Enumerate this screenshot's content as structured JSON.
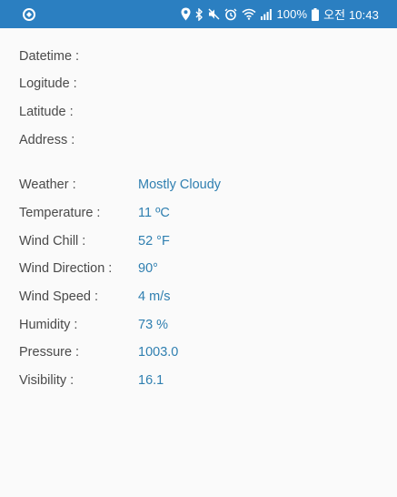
{
  "status_bar": {
    "battery_text": "100%",
    "time_text": "오전 10:43",
    "bg_color": "#2b7fc1",
    "icons": [
      "app-sync-icon",
      "location-icon",
      "bluetooth-icon",
      "mute-icon",
      "alarm-icon",
      "wifi-icon",
      "signal-icon",
      "battery-icon"
    ]
  },
  "location": {
    "datetime_label": "Datetime :",
    "longitude_label": "Logitude :",
    "latitude_label": "Latitude :",
    "address_label": "Address :"
  },
  "weather": {
    "weather_label": "Weather :",
    "weather_value": "Mostly Cloudy",
    "temperature_label": "Temperature :",
    "temperature_value": "11 ºC",
    "wind_chill_label": "Wind Chill :",
    "wind_chill_value": "52 °F",
    "wind_direction_label": "Wind Direction :",
    "wind_direction_value": "90°",
    "wind_speed_label": "Wind Speed :",
    "wind_speed_value": "4 m/s",
    "humidity_label": "Humidity :",
    "humidity_value": "73 %",
    "pressure_label": "Pressure :",
    "pressure_value": "1003.0",
    "visibility_label": "Visibility :",
    "visibility_value": "16.1"
  },
  "colors": {
    "label": "#4a4a4a",
    "value": "#2f7fb0",
    "background": "#fafafa"
  }
}
